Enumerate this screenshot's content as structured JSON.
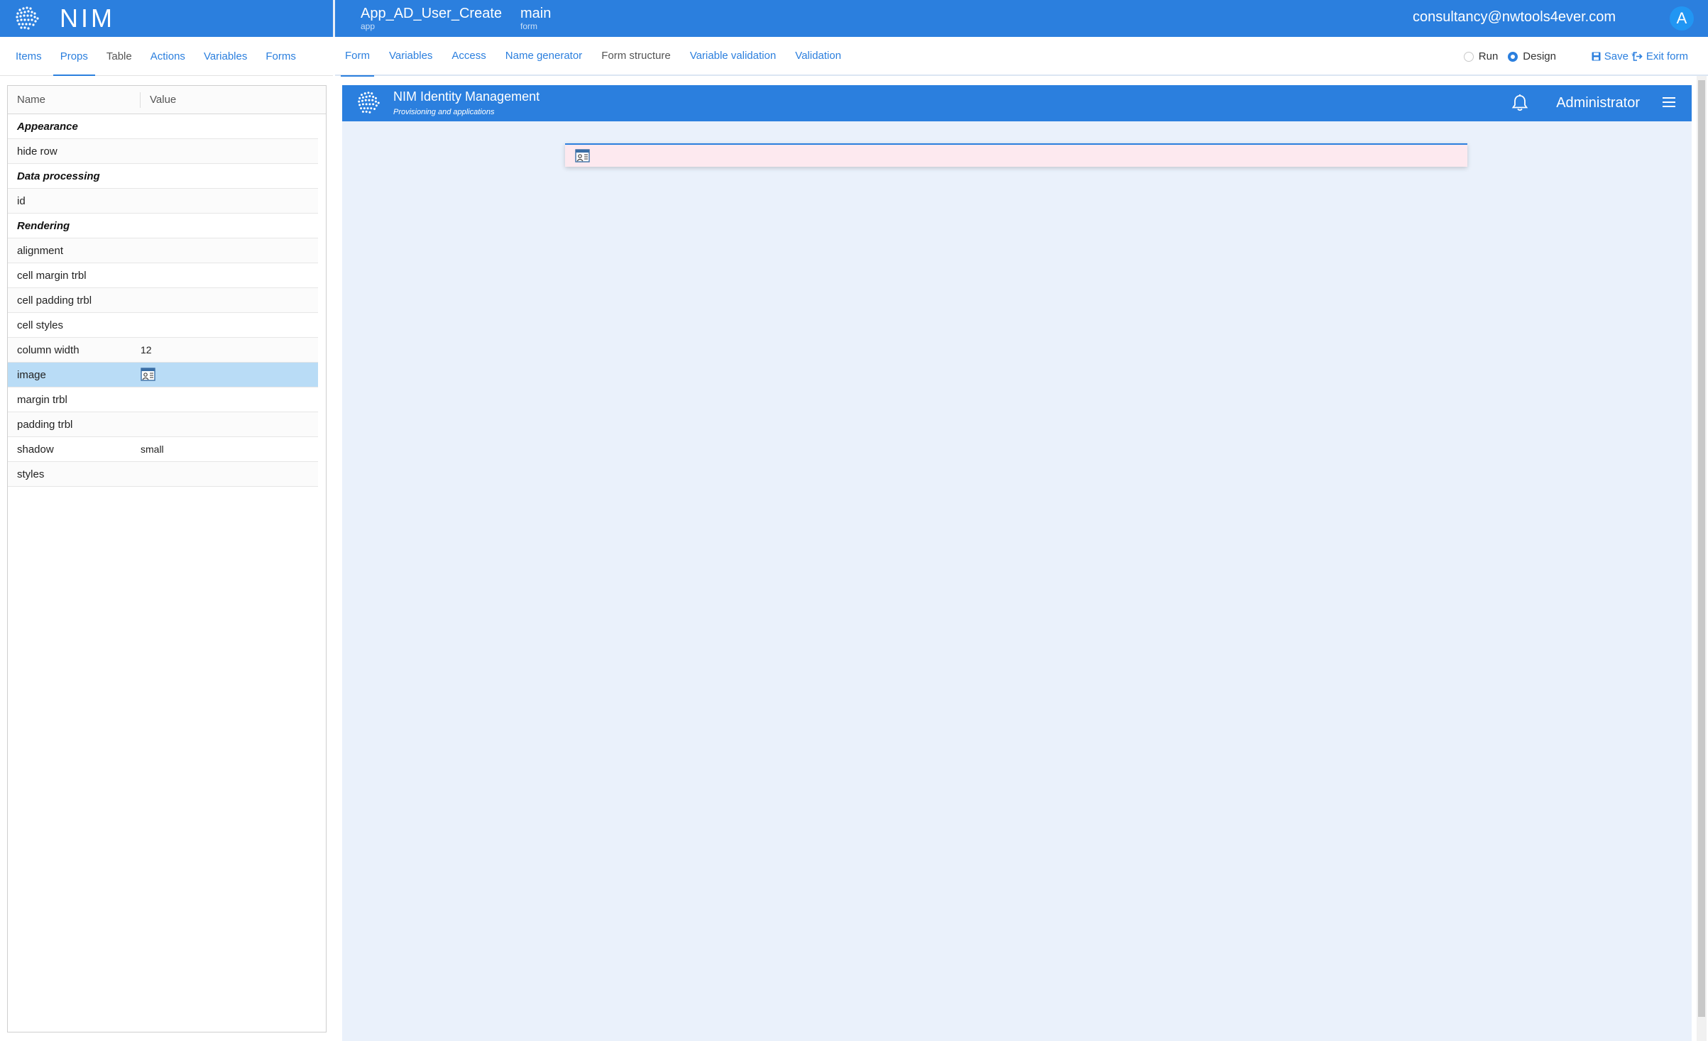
{
  "brand": {
    "name": "NIM"
  },
  "header": {
    "app_value": "App_AD_User_Create",
    "app_kind": "app",
    "form_value": "main",
    "form_kind": "form",
    "user_email": "consultancy@nwtools4ever.com",
    "avatar_letter": "A"
  },
  "left_tabs": [
    "Items",
    "Props",
    "Table",
    "Actions",
    "Variables",
    "Forms"
  ],
  "props": {
    "col_name": "Name",
    "col_value": "Value",
    "rows": [
      {
        "name": "Appearance",
        "value": ""
      },
      {
        "name": "hide row",
        "value": ""
      },
      {
        "name": "Data processing",
        "value": ""
      },
      {
        "name": "id",
        "value": ""
      },
      {
        "name": "Rendering",
        "value": ""
      },
      {
        "name": "alignment",
        "value": ""
      },
      {
        "name": "cell margin trbl",
        "value": ""
      },
      {
        "name": "cell padding trbl",
        "value": ""
      },
      {
        "name": "cell styles",
        "value": ""
      },
      {
        "name": "column width",
        "value": "12"
      },
      {
        "name": "image",
        "value": ""
      },
      {
        "name": "margin trbl",
        "value": ""
      },
      {
        "name": "padding trbl",
        "value": ""
      },
      {
        "name": "shadow",
        "value": "small"
      },
      {
        "name": "styles",
        "value": ""
      }
    ]
  },
  "right_tabs": [
    "Form",
    "Variables",
    "Access",
    "Name generator",
    "Form structure",
    "Variable validation",
    "Validation"
  ],
  "mode": {
    "run": "Run",
    "design": "Design",
    "selected": "Design"
  },
  "toolbar": {
    "save": "Save *",
    "exit": "Exit form"
  },
  "preview": {
    "title": "NIM Identity Management",
    "subtitle": "Provisioning and applications",
    "user": "Administrator"
  },
  "colors": {
    "accent": "#2b7fde",
    "canvas": "#eaf1fb",
    "selected_row": "#b9dcf6",
    "form_row": "#fde9ef"
  },
  "icons": [
    "nim-logo-icon",
    "bell-icon",
    "hamburger-menu-icon",
    "image-field-icon",
    "save-icon",
    "exit-icon"
  ]
}
